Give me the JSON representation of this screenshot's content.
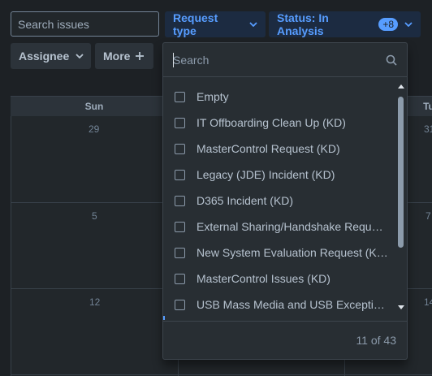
{
  "filters": {
    "search_placeholder": "Search issues",
    "request_type_label": "Request type",
    "status_label": "Status: In Analysis",
    "status_badge": "+8",
    "assignee_label": "Assignee",
    "more_label": "More"
  },
  "calendar": {
    "days": [
      "Sun",
      "Tu"
    ],
    "dates": [
      "29",
      "31",
      "5",
      "7",
      "12",
      "14"
    ]
  },
  "dropdown": {
    "search_placeholder": "Search",
    "items": [
      "Empty",
      "IT Offboarding Clean Up (KD)",
      "MasterControl Request (KD)",
      "Legacy (JDE) Incident (KD)",
      "D365 Incident (KD)",
      "External Sharing/Handshake Reques...",
      "New System Evaluation Request (KD)",
      "MasterControl Issues (KD)",
      "USB Mass Media and USB Exception..."
    ],
    "count": "11 of 43"
  },
  "colors": {
    "accent": "#579dff",
    "background": "#1d2125",
    "surface": "#282e33"
  }
}
